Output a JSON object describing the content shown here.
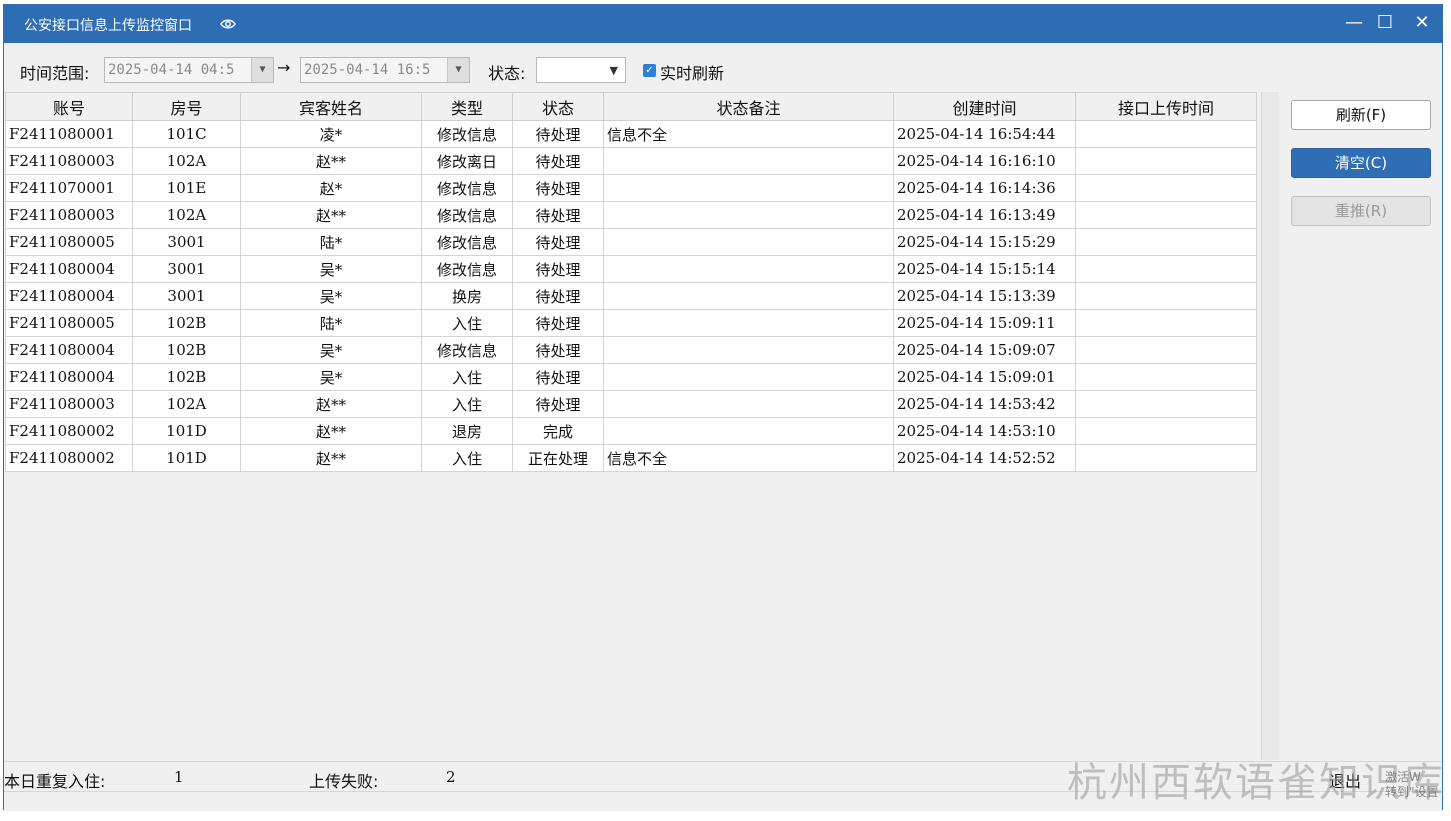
{
  "window": {
    "title": "公安接口信息上传监控窗口",
    "minimize": "—",
    "maximize": "☐",
    "close": "✕"
  },
  "toolbar": {
    "time_range_label": "时间范围:",
    "start_time": "2025-04-14 04:5",
    "arrow": "→",
    "end_time": "2025-04-14 16:5",
    "status_label": "状态:",
    "status_value": "",
    "realtime_label": "实时刷新",
    "realtime_checked": true
  },
  "table": {
    "headers": [
      "账号",
      "房号",
      "宾客姓名",
      "类型",
      "状态",
      "状态备注",
      "创建时间",
      "接口上传时间"
    ],
    "rows": [
      [
        "F2411080001",
        "101C",
        "凌*",
        "修改信息",
        "待处理",
        "信息不全",
        "2025-04-14 16:54:44",
        ""
      ],
      [
        "F2411080003",
        "102A",
        "赵**",
        "修改离日",
        "待处理",
        "",
        "2025-04-14 16:16:10",
        ""
      ],
      [
        "F2411070001",
        "101E",
        "赵*",
        "修改信息",
        "待处理",
        "",
        "2025-04-14 16:14:36",
        ""
      ],
      [
        "F2411080003",
        "102A",
        "赵**",
        "修改信息",
        "待处理",
        "",
        "2025-04-14 16:13:49",
        ""
      ],
      [
        "F2411080005",
        "3001",
        "陆*",
        "修改信息",
        "待处理",
        "",
        "2025-04-14 15:15:29",
        ""
      ],
      [
        "F2411080004",
        "3001",
        "吴*",
        "修改信息",
        "待处理",
        "",
        "2025-04-14 15:15:14",
        ""
      ],
      [
        "F2411080004",
        "3001",
        "吴*",
        "换房",
        "待处理",
        "",
        "2025-04-14 15:13:39",
        ""
      ],
      [
        "F2411080005",
        "102B",
        "陆*",
        "入住",
        "待处理",
        "",
        "2025-04-14 15:09:11",
        ""
      ],
      [
        "F2411080004",
        "102B",
        "吴*",
        "修改信息",
        "待处理",
        "",
        "2025-04-14 15:09:07",
        ""
      ],
      [
        "F2411080004",
        "102B",
        "吴*",
        "入住",
        "待处理",
        "",
        "2025-04-14 15:09:01",
        ""
      ],
      [
        "F2411080003",
        "102A",
        "赵**",
        "入住",
        "待处理",
        "",
        "2025-04-14 14:53:42",
        ""
      ],
      [
        "F2411080002",
        "101D",
        "赵**",
        "退房",
        "完成",
        "",
        "2025-04-14 14:53:10",
        ""
      ],
      [
        "F2411080002",
        "101D",
        "赵**",
        "入住",
        "正在处理",
        "信息不全",
        "2025-04-14 14:52:52",
        ""
      ]
    ]
  },
  "buttons": {
    "refresh": "刷新(F)",
    "clear": "清空(C)",
    "repush": "重推(R)"
  },
  "statusbar": {
    "repeat_checkin_label": "本日重复入住:",
    "repeat_checkin_value": "1",
    "upload_fail_label": "上传失败:",
    "upload_fail_value": "2",
    "exit": "退出"
  },
  "watermark": "杭州西软语雀知识库",
  "activate": {
    "line1": "激活W",
    "line2": "转到\"设置"
  },
  "colors": {
    "title_bar": "#2e6db4",
    "primary_button": "#2f6db5",
    "checkbox": "#2f7fd6"
  },
  "icons": [
    "eye-icon",
    "minimize-icon",
    "maximize-icon",
    "close-icon",
    "dropdown-arrow-icon",
    "checkbox-checked-icon"
  ]
}
